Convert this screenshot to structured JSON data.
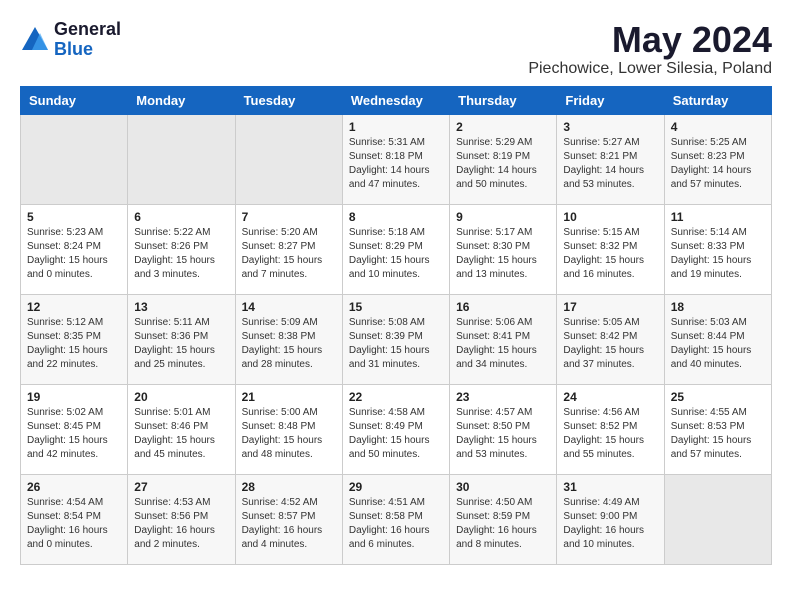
{
  "logo": {
    "general": "General",
    "blue": "Blue"
  },
  "title": {
    "month": "May 2024",
    "location": "Piechowice, Lower Silesia, Poland"
  },
  "headers": [
    "Sunday",
    "Monday",
    "Tuesday",
    "Wednesday",
    "Thursday",
    "Friday",
    "Saturday"
  ],
  "weeks": [
    [
      {
        "day": "",
        "sunrise": "",
        "sunset": "",
        "daylight": ""
      },
      {
        "day": "",
        "sunrise": "",
        "sunset": "",
        "daylight": ""
      },
      {
        "day": "",
        "sunrise": "",
        "sunset": "",
        "daylight": ""
      },
      {
        "day": "1",
        "sunrise": "Sunrise: 5:31 AM",
        "sunset": "Sunset: 8:18 PM",
        "daylight": "Daylight: 14 hours and 47 minutes."
      },
      {
        "day": "2",
        "sunrise": "Sunrise: 5:29 AM",
        "sunset": "Sunset: 8:19 PM",
        "daylight": "Daylight: 14 hours and 50 minutes."
      },
      {
        "day": "3",
        "sunrise": "Sunrise: 5:27 AM",
        "sunset": "Sunset: 8:21 PM",
        "daylight": "Daylight: 14 hours and 53 minutes."
      },
      {
        "day": "4",
        "sunrise": "Sunrise: 5:25 AM",
        "sunset": "Sunset: 8:23 PM",
        "daylight": "Daylight: 14 hours and 57 minutes."
      }
    ],
    [
      {
        "day": "5",
        "sunrise": "Sunrise: 5:23 AM",
        "sunset": "Sunset: 8:24 PM",
        "daylight": "Daylight: 15 hours and 0 minutes."
      },
      {
        "day": "6",
        "sunrise": "Sunrise: 5:22 AM",
        "sunset": "Sunset: 8:26 PM",
        "daylight": "Daylight: 15 hours and 3 minutes."
      },
      {
        "day": "7",
        "sunrise": "Sunrise: 5:20 AM",
        "sunset": "Sunset: 8:27 PM",
        "daylight": "Daylight: 15 hours and 7 minutes."
      },
      {
        "day": "8",
        "sunrise": "Sunrise: 5:18 AM",
        "sunset": "Sunset: 8:29 PM",
        "daylight": "Daylight: 15 hours and 10 minutes."
      },
      {
        "day": "9",
        "sunrise": "Sunrise: 5:17 AM",
        "sunset": "Sunset: 8:30 PM",
        "daylight": "Daylight: 15 hours and 13 minutes."
      },
      {
        "day": "10",
        "sunrise": "Sunrise: 5:15 AM",
        "sunset": "Sunset: 8:32 PM",
        "daylight": "Daylight: 15 hours and 16 minutes."
      },
      {
        "day": "11",
        "sunrise": "Sunrise: 5:14 AM",
        "sunset": "Sunset: 8:33 PM",
        "daylight": "Daylight: 15 hours and 19 minutes."
      }
    ],
    [
      {
        "day": "12",
        "sunrise": "Sunrise: 5:12 AM",
        "sunset": "Sunset: 8:35 PM",
        "daylight": "Daylight: 15 hours and 22 minutes."
      },
      {
        "day": "13",
        "sunrise": "Sunrise: 5:11 AM",
        "sunset": "Sunset: 8:36 PM",
        "daylight": "Daylight: 15 hours and 25 minutes."
      },
      {
        "day": "14",
        "sunrise": "Sunrise: 5:09 AM",
        "sunset": "Sunset: 8:38 PM",
        "daylight": "Daylight: 15 hours and 28 minutes."
      },
      {
        "day": "15",
        "sunrise": "Sunrise: 5:08 AM",
        "sunset": "Sunset: 8:39 PM",
        "daylight": "Daylight: 15 hours and 31 minutes."
      },
      {
        "day": "16",
        "sunrise": "Sunrise: 5:06 AM",
        "sunset": "Sunset: 8:41 PM",
        "daylight": "Daylight: 15 hours and 34 minutes."
      },
      {
        "day": "17",
        "sunrise": "Sunrise: 5:05 AM",
        "sunset": "Sunset: 8:42 PM",
        "daylight": "Daylight: 15 hours and 37 minutes."
      },
      {
        "day": "18",
        "sunrise": "Sunrise: 5:03 AM",
        "sunset": "Sunset: 8:44 PM",
        "daylight": "Daylight: 15 hours and 40 minutes."
      }
    ],
    [
      {
        "day": "19",
        "sunrise": "Sunrise: 5:02 AM",
        "sunset": "Sunset: 8:45 PM",
        "daylight": "Daylight: 15 hours and 42 minutes."
      },
      {
        "day": "20",
        "sunrise": "Sunrise: 5:01 AM",
        "sunset": "Sunset: 8:46 PM",
        "daylight": "Daylight: 15 hours and 45 minutes."
      },
      {
        "day": "21",
        "sunrise": "Sunrise: 5:00 AM",
        "sunset": "Sunset: 8:48 PM",
        "daylight": "Daylight: 15 hours and 48 minutes."
      },
      {
        "day": "22",
        "sunrise": "Sunrise: 4:58 AM",
        "sunset": "Sunset: 8:49 PM",
        "daylight": "Daylight: 15 hours and 50 minutes."
      },
      {
        "day": "23",
        "sunrise": "Sunrise: 4:57 AM",
        "sunset": "Sunset: 8:50 PM",
        "daylight": "Daylight: 15 hours and 53 minutes."
      },
      {
        "day": "24",
        "sunrise": "Sunrise: 4:56 AM",
        "sunset": "Sunset: 8:52 PM",
        "daylight": "Daylight: 15 hours and 55 minutes."
      },
      {
        "day": "25",
        "sunrise": "Sunrise: 4:55 AM",
        "sunset": "Sunset: 8:53 PM",
        "daylight": "Daylight: 15 hours and 57 minutes."
      }
    ],
    [
      {
        "day": "26",
        "sunrise": "Sunrise: 4:54 AM",
        "sunset": "Sunset: 8:54 PM",
        "daylight": "Daylight: 16 hours and 0 minutes."
      },
      {
        "day": "27",
        "sunrise": "Sunrise: 4:53 AM",
        "sunset": "Sunset: 8:56 PM",
        "daylight": "Daylight: 16 hours and 2 minutes."
      },
      {
        "day": "28",
        "sunrise": "Sunrise: 4:52 AM",
        "sunset": "Sunset: 8:57 PM",
        "daylight": "Daylight: 16 hours and 4 minutes."
      },
      {
        "day": "29",
        "sunrise": "Sunrise: 4:51 AM",
        "sunset": "Sunset: 8:58 PM",
        "daylight": "Daylight: 16 hours and 6 minutes."
      },
      {
        "day": "30",
        "sunrise": "Sunrise: 4:50 AM",
        "sunset": "Sunset: 8:59 PM",
        "daylight": "Daylight: 16 hours and 8 minutes."
      },
      {
        "day": "31",
        "sunrise": "Sunrise: 4:49 AM",
        "sunset": "Sunset: 9:00 PM",
        "daylight": "Daylight: 16 hours and 10 minutes."
      },
      {
        "day": "",
        "sunrise": "",
        "sunset": "",
        "daylight": ""
      }
    ]
  ]
}
